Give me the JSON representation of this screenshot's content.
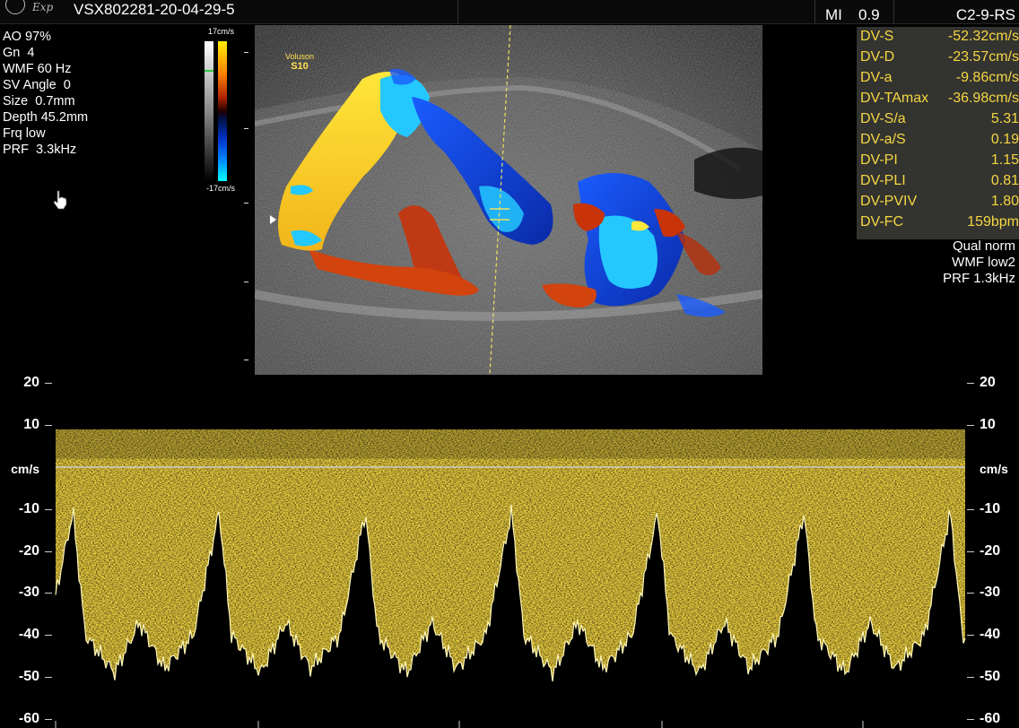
{
  "header": {
    "exp_label": "Exp",
    "patient_id": "VSX802281-20-04-29-5",
    "mi_label": "MI",
    "mi_value": "0.9",
    "probe": "C2-9-RS"
  },
  "left_params": [
    "AO 97%",
    "Gn  4",
    "WMF 60 Hz",
    "SV Angle  0",
    "Size  0.7mm",
    "Depth 45.2mm",
    "Frq low",
    "PRF  3.3kHz"
  ],
  "color_scale": {
    "top_label": "17cm/s",
    "bottom_label": "-17cm/s"
  },
  "image_overlay": {
    "brand": "Voluson",
    "model": "S10"
  },
  "measurements": [
    {
      "label": "DV-S",
      "value": "-52.32cm/s"
    },
    {
      "label": "DV-D",
      "value": "-23.57cm/s"
    },
    {
      "label": "DV-a",
      "value": "-9.86cm/s"
    },
    {
      "label": "DV-TAmax",
      "value": "-36.98cm/s"
    },
    {
      "label": "DV-S/a",
      "value": "5.31"
    },
    {
      "label": "DV-a/S",
      "value": "0.19"
    },
    {
      "label": "DV-PI",
      "value": "1.15"
    },
    {
      "label": "DV-PLI",
      "value": "0.81"
    },
    {
      "label": "DV-PVIV",
      "value": "1.80"
    },
    {
      "label": "DV-FC",
      "value": "159bpm"
    }
  ],
  "right_params": [
    "Qual norm",
    "WMF low2",
    "PRF  1.3kHz"
  ],
  "doppler": {
    "unit_label": "cm/s",
    "ticks": [
      20,
      10,
      -10,
      -20,
      -30,
      -40,
      -50,
      -60
    ],
    "ylim": [
      -60,
      20
    ]
  },
  "colors": {
    "spectrum": "#f5d742",
    "measure_text": "#f5d742",
    "measure_bg": "#333330",
    "flow_red": "#c8330a",
    "flow_blue": "#1446d8",
    "flow_yellow": "#ffd21a",
    "flow_cyan": "#20c8ff"
  }
}
